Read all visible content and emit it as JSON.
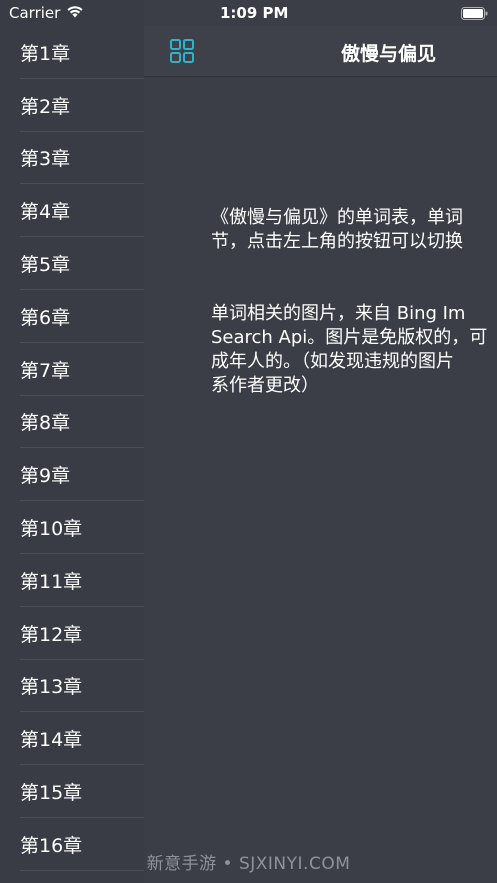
{
  "status_bar": {
    "carrier": "Carrier",
    "time": "1:09 PM",
    "wifi_icon": "wifi-icon",
    "battery_icon": "battery-full-icon"
  },
  "nav": {
    "title": "傲慢与偏见",
    "menu_icon": "grid-icon",
    "accent_color": "#2fb3c6"
  },
  "intro": {
    "paragraph1": "《傲慢与偏见》的单词表，单词\n节，点击左上角的按钮可以切换",
    "paragraph2": " 单词相关的图片，来自 Bing Im\nSearch Api。图片是免版权的，可\n成年人的。（如发现违规的图片\n系作者更改）"
  },
  "sidebar": {
    "chapters": [
      {
        "label": "第1章"
      },
      {
        "label": "第2章"
      },
      {
        "label": "第3章"
      },
      {
        "label": "第4章"
      },
      {
        "label": "第5章"
      },
      {
        "label": "第6章"
      },
      {
        "label": "第7章"
      },
      {
        "label": "第8章"
      },
      {
        "label": "第9章"
      },
      {
        "label": "第10章"
      },
      {
        "label": "第11章"
      },
      {
        "label": "第12章"
      },
      {
        "label": "第13章"
      },
      {
        "label": "第14章"
      },
      {
        "label": "第15章"
      },
      {
        "label": "第16章"
      }
    ]
  },
  "watermark": "新意手游 • SJXINYI.COM"
}
